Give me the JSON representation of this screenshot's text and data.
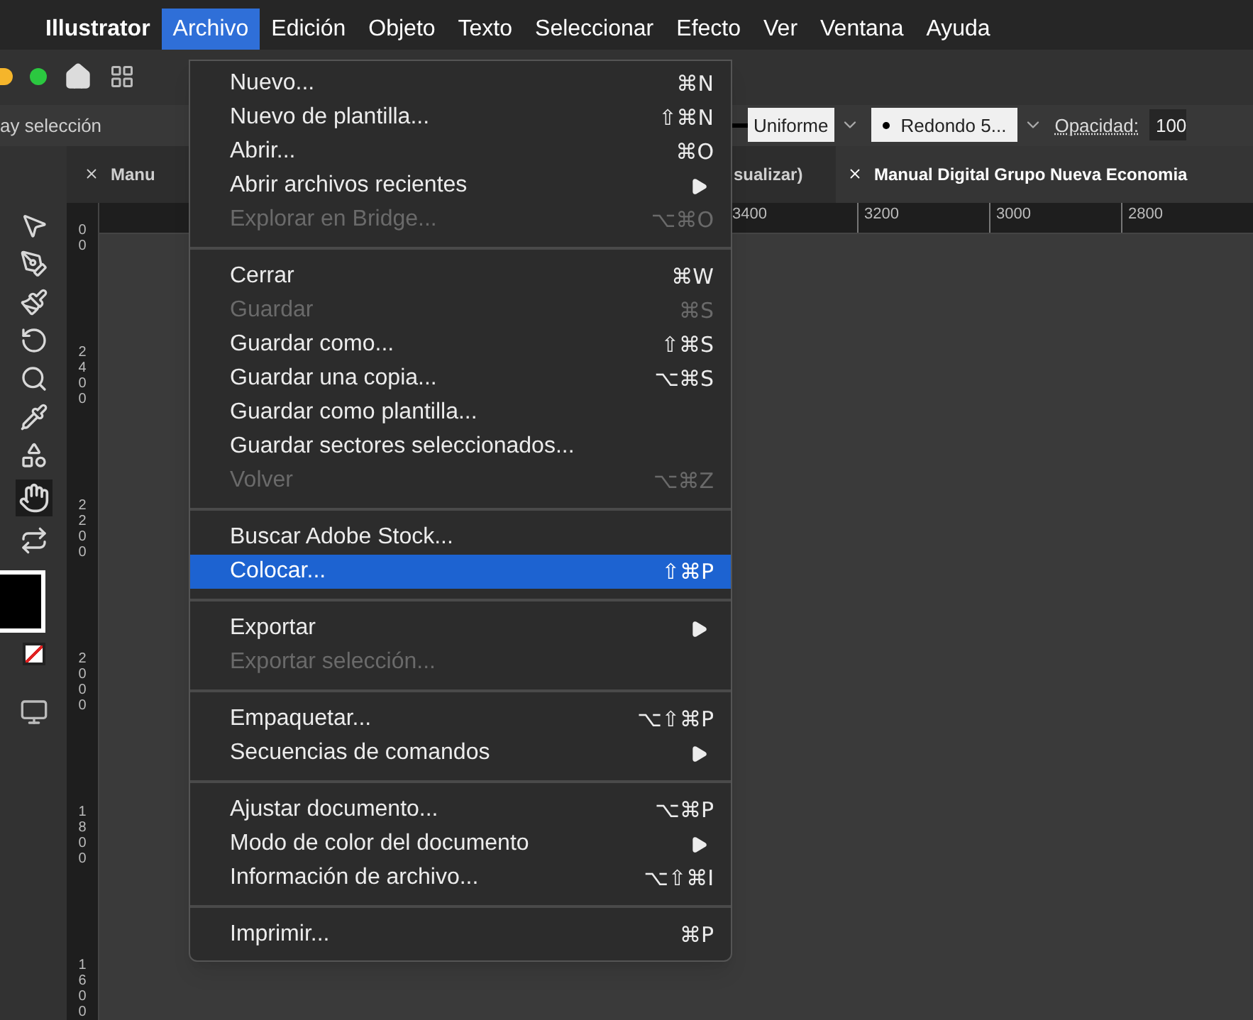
{
  "menu_bar": [
    {
      "label": "Illustrator",
      "kind": "app",
      "selected": false
    },
    {
      "label": "Archivo",
      "kind": "menu",
      "selected": true
    },
    {
      "label": "Edición",
      "kind": "menu",
      "selected": false
    },
    {
      "label": "Objeto",
      "kind": "menu",
      "selected": false
    },
    {
      "label": "Texto",
      "kind": "menu",
      "selected": false
    },
    {
      "label": "Seleccionar",
      "kind": "menu",
      "selected": false
    },
    {
      "label": "Efecto",
      "kind": "menu",
      "selected": false
    },
    {
      "label": "Ver",
      "kind": "menu",
      "selected": false
    },
    {
      "label": "Ventana",
      "kind": "menu",
      "selected": false
    },
    {
      "label": "Ayuda",
      "kind": "menu",
      "selected": false
    }
  ],
  "control_bar": {
    "status": "ay selección",
    "stroke_style": "Uniforme",
    "brush": "Redondo 5...",
    "opacity_label": "Opacidad:",
    "opacity_value": "100"
  },
  "tabs": [
    {
      "label": "Manu",
      "selected": false
    },
    {
      "label": "sualizar)",
      "selected": false
    },
    {
      "label": "Manual Digital Grupo Nueva Economia",
      "selected": true
    }
  ],
  "horizontal_ruler": [
    "3400",
    "3200",
    "3000",
    "2800"
  ],
  "vertical_ruler": [
    "00",
    "2400",
    "2200",
    "2000",
    "1800",
    "1600"
  ],
  "file_menu": [
    {
      "kind": "item",
      "label": "Nuevo...",
      "shortcut": "⌘N",
      "disabled": false,
      "selected": false,
      "submenu": false
    },
    {
      "kind": "item",
      "label": "Nuevo de plantilla...",
      "shortcut": "⇧⌘N",
      "disabled": false,
      "selected": false,
      "submenu": false
    },
    {
      "kind": "item",
      "label": "Abrir...",
      "shortcut": "⌘O",
      "disabled": false,
      "selected": false,
      "submenu": false
    },
    {
      "kind": "item",
      "label": "Abrir archivos recientes",
      "disabled": false,
      "selected": false,
      "submenu": true
    },
    {
      "kind": "item",
      "label": "Explorar en Bridge...",
      "shortcut": "⌥⌘O",
      "disabled": true,
      "selected": false,
      "submenu": false
    },
    {
      "kind": "separator"
    },
    {
      "kind": "item",
      "label": "Cerrar",
      "shortcut": "⌘W",
      "disabled": false,
      "selected": false,
      "submenu": false
    },
    {
      "kind": "item",
      "label": "Guardar",
      "shortcut": "⌘S",
      "disabled": true,
      "selected": false,
      "submenu": false
    },
    {
      "kind": "item",
      "label": "Guardar como...",
      "shortcut": "⇧⌘S",
      "disabled": false,
      "selected": false,
      "submenu": false
    },
    {
      "kind": "item",
      "label": "Guardar una copia...",
      "shortcut": "⌥⌘S",
      "disabled": false,
      "selected": false,
      "submenu": false
    },
    {
      "kind": "item",
      "label": "Guardar como plantilla...",
      "disabled": false,
      "selected": false,
      "submenu": false
    },
    {
      "kind": "item",
      "label": "Guardar sectores seleccionados...",
      "disabled": false,
      "selected": false,
      "submenu": false
    },
    {
      "kind": "item",
      "label": "Volver",
      "shortcut": "⌥⌘Z",
      "disabled": true,
      "selected": false,
      "submenu": false
    },
    {
      "kind": "separator"
    },
    {
      "kind": "item",
      "label": "Buscar Adobe Stock...",
      "disabled": false,
      "selected": false,
      "submenu": false
    },
    {
      "kind": "item",
      "label": "Colocar...",
      "shortcut": "⇧⌘P",
      "disabled": false,
      "selected": true,
      "submenu": false
    },
    {
      "kind": "separator"
    },
    {
      "kind": "item",
      "label": "Exportar",
      "disabled": false,
      "selected": false,
      "submenu": true
    },
    {
      "kind": "item",
      "label": "Exportar selección...",
      "disabled": true,
      "selected": false,
      "submenu": false
    },
    {
      "kind": "separator"
    },
    {
      "kind": "item",
      "label": "Empaquetar...",
      "shortcut": "⌥⇧⌘P",
      "disabled": false,
      "selected": false,
      "submenu": false
    },
    {
      "kind": "item",
      "label": "Secuencias de comandos",
      "disabled": false,
      "selected": false,
      "submenu": true
    },
    {
      "kind": "separator"
    },
    {
      "kind": "item",
      "label": "Ajustar documento...",
      "shortcut": "⌥⌘P",
      "disabled": false,
      "selected": false,
      "submenu": false
    },
    {
      "kind": "item",
      "label": "Modo de color del documento",
      "disabled": false,
      "selected": false,
      "submenu": true
    },
    {
      "kind": "item",
      "label": "Información de archivo...",
      "shortcut": "⌥⇧⌘I",
      "disabled": false,
      "selected": false,
      "submenu": false
    },
    {
      "kind": "separator"
    },
    {
      "kind": "item",
      "label": "Imprimir...",
      "shortcut": "⌘P",
      "disabled": false,
      "selected": false,
      "submenu": false
    }
  ]
}
